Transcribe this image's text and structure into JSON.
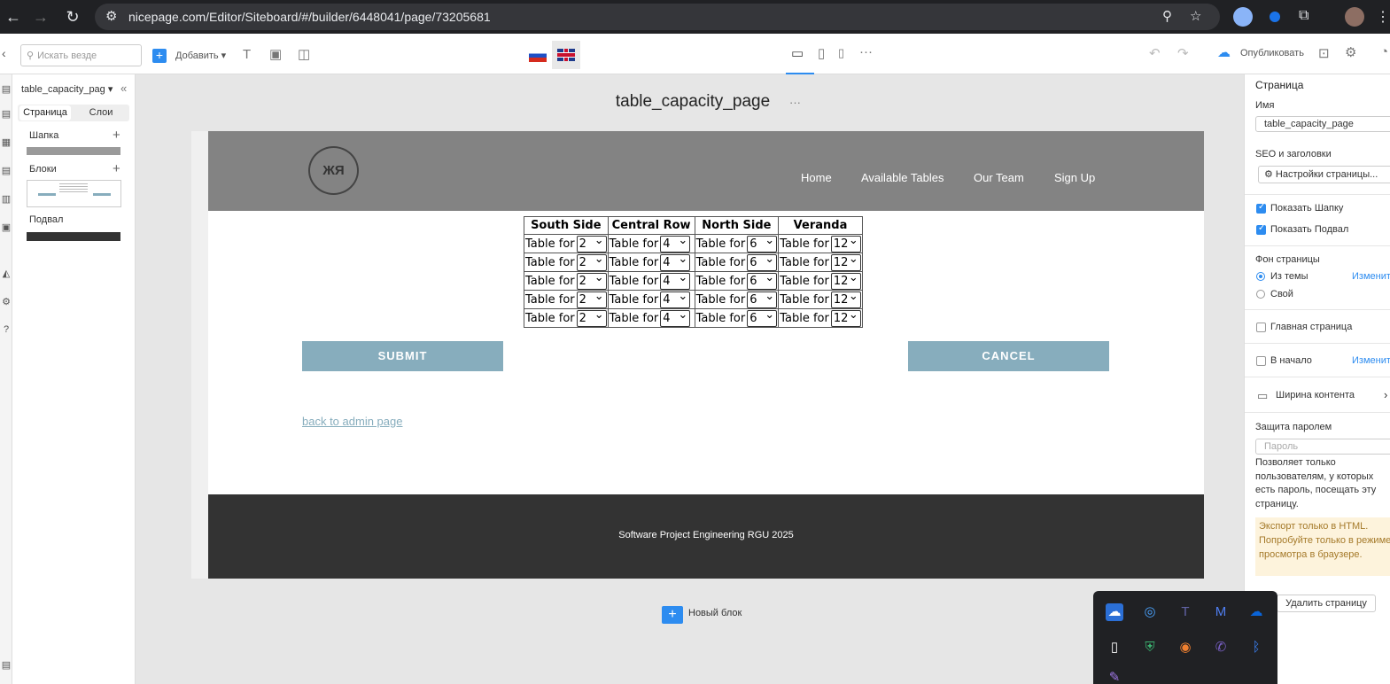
{
  "browser": {
    "url": "nicepage.com/Editor/Siteboard/#/builder/6448041/page/73205681"
  },
  "toolbar": {
    "search_placeholder": "Искать везде",
    "add_label": "Добавить",
    "publish_label": "Опубликовать"
  },
  "left_panel": {
    "page_select": "table_capacity_pag",
    "tab_page": "Страница",
    "tab_layers": "Слои",
    "header_label": "Шапка",
    "blocks_label": "Блоки",
    "footer_label": "Подвал"
  },
  "canvas": {
    "page_title": "table_capacity_page",
    "title_menu": "···",
    "nav": [
      "Home",
      "Available Tables",
      "Our Team",
      "Sign Up"
    ],
    "table": {
      "headers": [
        "South Side",
        "Central Row",
        "North Side",
        "Veranda"
      ],
      "cell_label": "Table for",
      "rows": [
        [
          "2",
          "4",
          "6",
          "12"
        ],
        [
          "2",
          "4",
          "6",
          "12"
        ],
        [
          "2",
          "4",
          "6",
          "12"
        ],
        [
          "2",
          "4",
          "6",
          "12"
        ],
        [
          "2",
          "4",
          "6",
          "12"
        ]
      ]
    },
    "submit_label": "SUBMIT",
    "cancel_label": "CANCEL",
    "back_link": "back to admin page",
    "footer_text": "Software Project Engineering RGU 2025",
    "new_block_label": "Новый блок"
  },
  "right_panel": {
    "section_title": "Страница",
    "name_label": "Имя",
    "name_value": "table_capacity_page",
    "seo_label": "SEO и заголовки",
    "settings_button": "Настройки страницы...",
    "show_header": "Показать Шапку",
    "show_footer": "Показать Подвал",
    "bg_label": "Фон страницы",
    "bg_theme": "Из темы",
    "bg_custom": "Свой",
    "change_link": "Изменить",
    "home_page": "Главная страница",
    "at_start": "В начало",
    "change_link2": "Изменить",
    "content_width": "Ширина контента",
    "password_label": "Защита паролем",
    "password_placeholder": "Пароль",
    "password_help": "Позволяет только пользователям, у которых есть пароль, посещать эту страницу.",
    "export_warning": "Экспорт только в HTML. Попробуйте только в режиме просмотра в браузере.",
    "delete_button": "Удалить страницу"
  },
  "colors": {
    "accent": "#2d8cf0",
    "site_header": "#838383",
    "button": "#87adbd",
    "footer": "#333333"
  }
}
